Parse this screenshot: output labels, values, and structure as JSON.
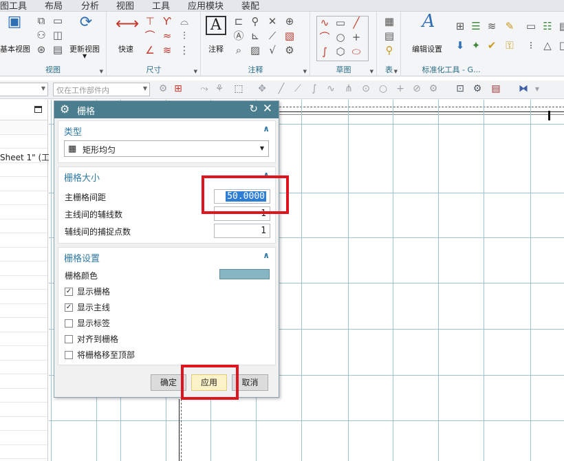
{
  "menu": [
    "图工具",
    "布局",
    "分析",
    "视图",
    "工具",
    "应用模块",
    "装配"
  ],
  "ribbon": {
    "groups": [
      {
        "label": "视图",
        "buttons": [
          "基本视图",
          "更新视图"
        ]
      },
      {
        "label": "尺寸",
        "buttons": [
          "快速"
        ]
      },
      {
        "label": "注释",
        "buttons": [
          "注释"
        ]
      },
      {
        "label": "草图",
        "buttons": []
      },
      {
        "label": "表",
        "buttons": []
      },
      {
        "label": "标准化工具 - G...",
        "buttons": [
          "编辑设置"
        ]
      }
    ]
  },
  "toolbar2": {
    "filter_value": "",
    "scope_value": "仅在工作部件内"
  },
  "left_pane": {
    "sheet_label": "Sheet 1\" (工"
  },
  "dialog": {
    "title": "栅格",
    "type_section": {
      "header": "类型",
      "selected": "矩形均匀"
    },
    "size_section": {
      "header": "栅格大小",
      "main_spacing_label": "主栅格间距",
      "main_spacing_value": "50.0000",
      "aux_lines_label": "主线间的辅线数",
      "aux_lines_value": "1",
      "snap_points_label": "辅线间的捕捉点数",
      "snap_points_value": "1"
    },
    "settings_section": {
      "header": "栅格设置",
      "color_label": "栅格颜色",
      "grid_color": "#86b6c3",
      "checkboxes": [
        {
          "label": "显示栅格",
          "checked": true
        },
        {
          "label": "显示主线",
          "checked": true
        },
        {
          "label": "显示标签",
          "checked": false
        },
        {
          "label": "对齐到栅格",
          "checked": false
        },
        {
          "label": "将栅格移至顶部",
          "checked": false
        }
      ]
    },
    "buttons": {
      "ok": "确定",
      "apply": "应用",
      "cancel": "取消"
    }
  },
  "colors": {
    "accent": "#4a7d8e",
    "highlight": "#e0141f",
    "selection": "#2e7fd4"
  }
}
